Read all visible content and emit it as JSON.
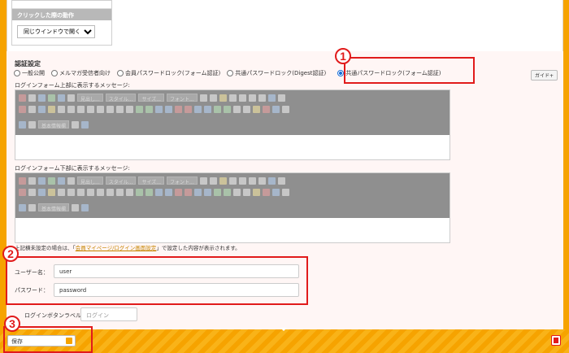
{
  "click_action": {
    "heading": "クリックした際の動作",
    "select_value": "同じウインドウで開く"
  },
  "auth": {
    "title": "認証設定",
    "options": [
      "一般公開",
      "メルマガ受信者向け",
      "会員パスワードロック(フォーム認証)",
      "共通パスワードロック(Digest認証)",
      "共通パスワードロック(フォーム認証)"
    ],
    "selected_index": 4,
    "guide_label": "ガイド+"
  },
  "editor_top": {
    "label": "ログインフォーム上部に表示するメッセージ:",
    "dropdowns": [
      "見出し...",
      "スタイル...",
      "サイズ...",
      "フォント..."
    ],
    "row3_dropdown": "基本情報欄"
  },
  "editor_bottom": {
    "label": "ログインフォーム下部に表示するメッセージ:",
    "dropdowns": [
      "見出し...",
      "スタイル...",
      "サイズ...",
      "フォント..."
    ],
    "row3_dropdown": "基本情報欄"
  },
  "note": {
    "prefix": "上記横未設定の場合は、「",
    "link": "会員マイページ/ログイン画面設定",
    "suffix": "」で設定した内容が表示されます。"
  },
  "credentials": {
    "username_label": "ユーザー名：",
    "username_value": "user",
    "password_label": "パスワード：",
    "password_value": "password"
  },
  "login_button": {
    "label": "ログインボタンラベル：",
    "placeholder": "ログイン"
  },
  "footer": {
    "save_label": "保存"
  },
  "badges": [
    "1",
    "2",
    "3"
  ],
  "colors": {
    "accent": "#f6a300",
    "highlight": "#e11b1b",
    "link": "#c68400"
  }
}
